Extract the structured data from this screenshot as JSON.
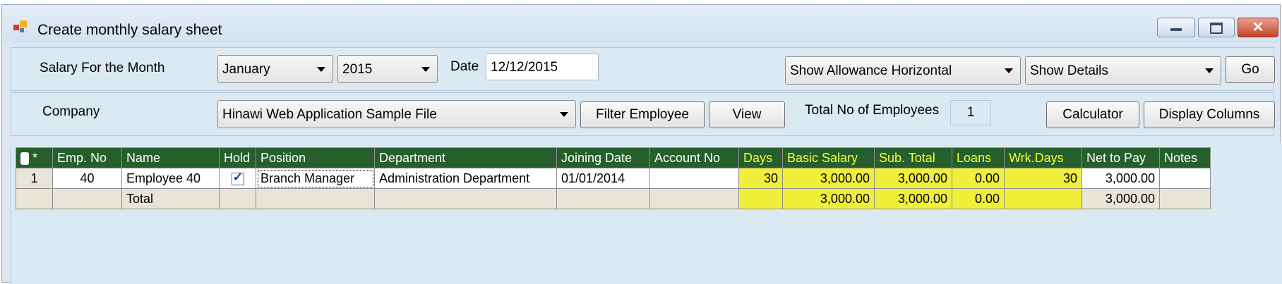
{
  "window": {
    "title": "Create monthly salary sheet",
    "close_glyph": "✕"
  },
  "filters": {
    "salary_month_label": "Salary For the Month",
    "month": "January",
    "year": "2015",
    "date_label": "Date",
    "date": "12/12/2015",
    "allowance_view": "Show Allowance Horizontal",
    "details_view": "Show Details",
    "go_label": "Go",
    "company_label": "Company",
    "company": "Hinawi Web Application Sample File",
    "filter_employee_label": "Filter Employee",
    "view_label": "View",
    "total_employees_label": "Total No of Employees",
    "total_employees": "1",
    "calculator_label": "Calculator",
    "display_columns_label": "Display Columns"
  },
  "grid": {
    "corner_star": "*",
    "columns": [
      "Emp. No",
      "Name",
      "Hold",
      "Position",
      "Department",
      "Joining Date",
      "Account No",
      "Days",
      "Basic Salary",
      "Sub. Total",
      "Loans",
      "Wrk.Days",
      "Net to Pay",
      "Notes"
    ],
    "rows": [
      {
        "row_no": "1",
        "emp_no": "40",
        "name": "Employee 40",
        "hold": true,
        "position": "Branch Manager",
        "department": "Administration Department",
        "joining_date": "01/01/2014",
        "account_no": "",
        "days": "30",
        "basic_salary": "3,000.00",
        "sub_total": "3,000.00",
        "loans": "0.00",
        "wrk_days": "30",
        "net_to_pay": "3,000.00",
        "notes": ""
      }
    ],
    "total": {
      "label": "Total",
      "basic_salary": "3,000.00",
      "sub_total": "3,000.00",
      "loans": "0.00",
      "net_to_pay": "3,000.00"
    },
    "header_bg": "#275f2c",
    "highlight_color": "#f5f400"
  }
}
